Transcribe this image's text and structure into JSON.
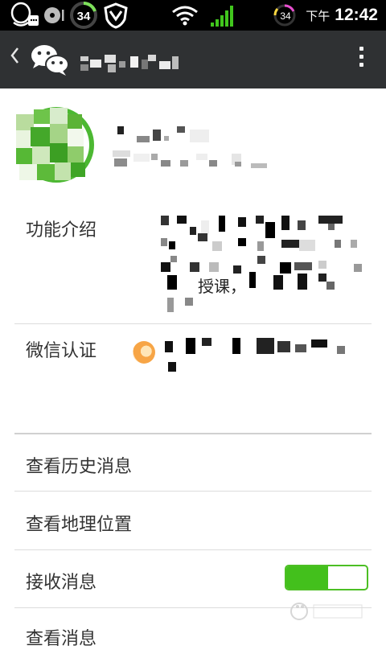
{
  "status_bar": {
    "badge_left": "34",
    "badge_right": "34",
    "ampm": "下午",
    "time": "12:42",
    "icons": [
      "qq-icon",
      "media-icon",
      "battery-ring-icon",
      "shield-icon",
      "wifi-icon",
      "signal-icon",
      "battery-ring-icon"
    ]
  },
  "toolbar": {
    "back_icon": "back-chevron-icon",
    "logo_icon": "wechat-logo-icon",
    "more_icon": "more-vertical-icon"
  },
  "profile": {
    "fields": [
      {
        "label": "功能介绍",
        "visible_fragments": [
          "授课，"
        ]
      },
      {
        "label": "微信认证",
        "verify_icon": "verified-badge-icon"
      }
    ]
  },
  "menu": {
    "history": "查看历史消息",
    "location": "查看地理位置",
    "receive": "接收消息",
    "view": "查看消息"
  },
  "toggle": {
    "receive_on": true
  },
  "colors": {
    "accent": "#43c01c",
    "titlebar": "#2f3133",
    "statusbar": "#000000"
  }
}
